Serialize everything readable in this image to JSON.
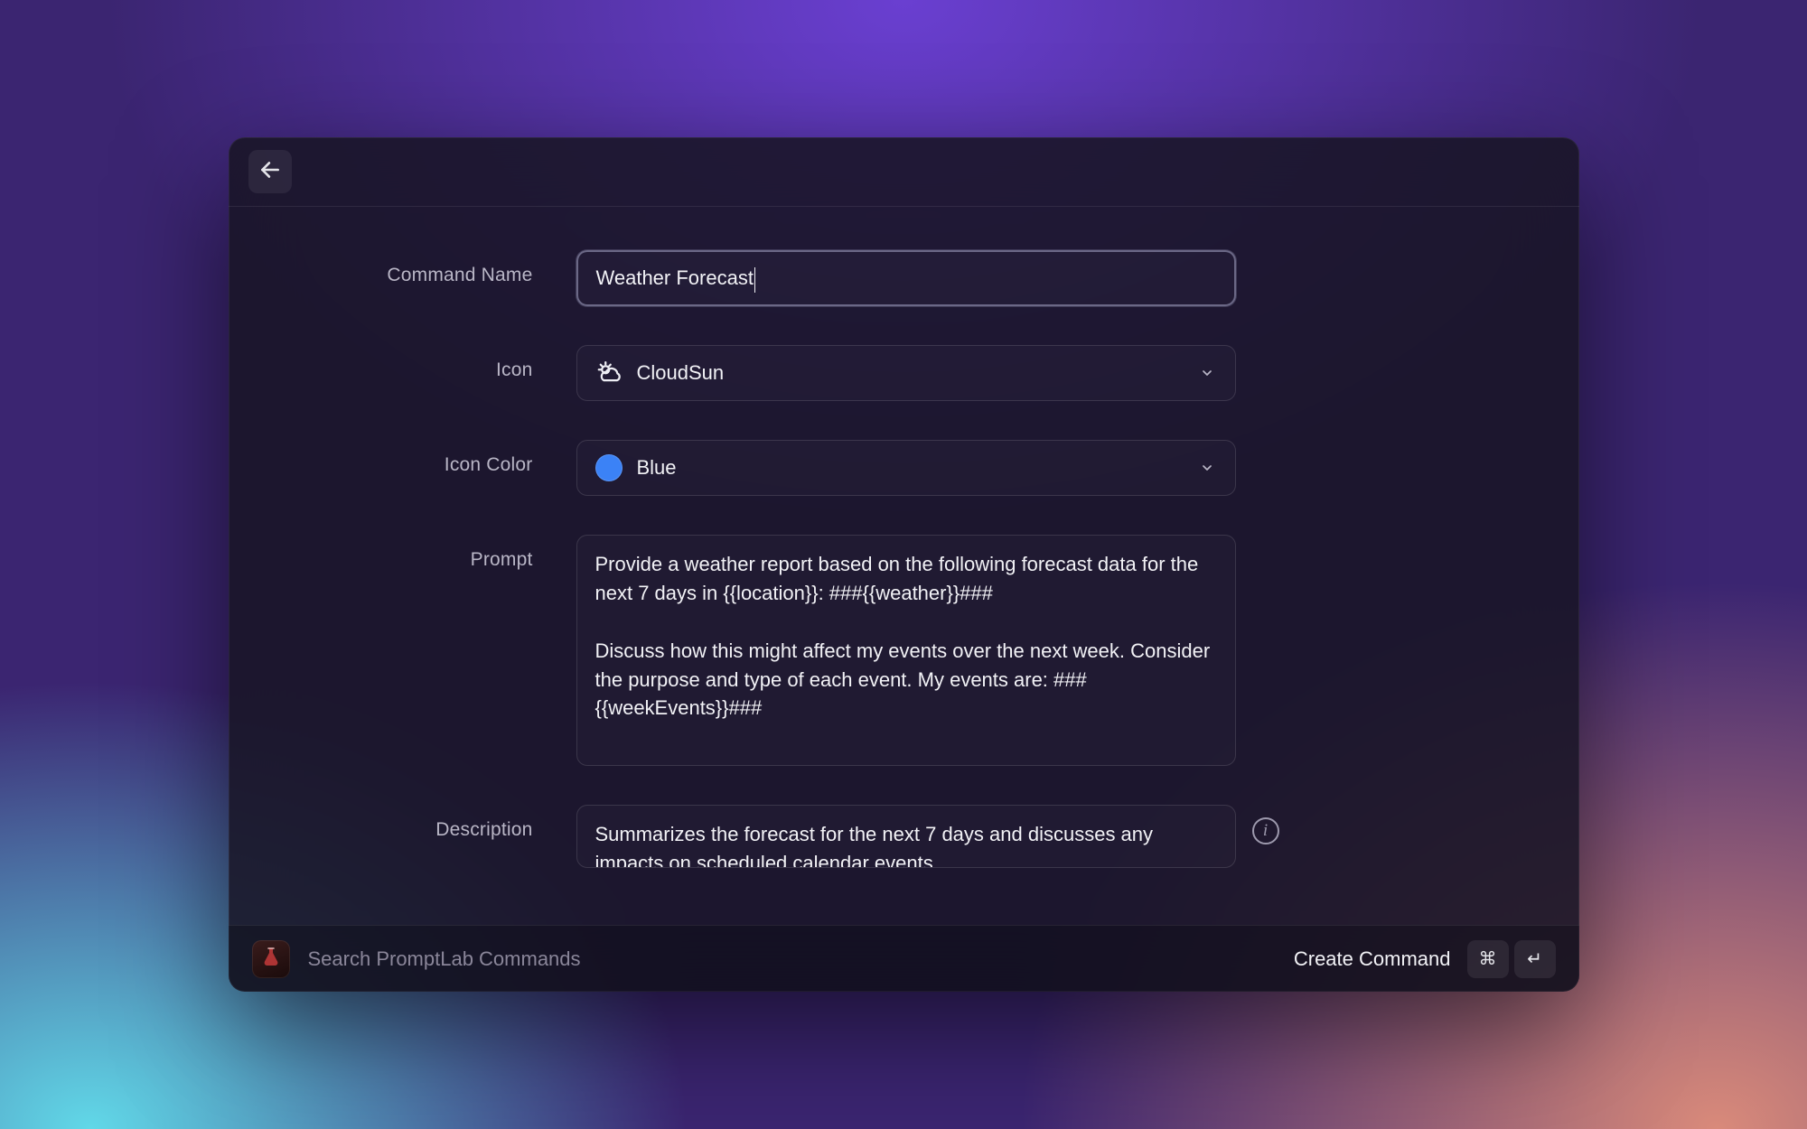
{
  "labels": {
    "command_name": "Command Name",
    "icon": "Icon",
    "icon_color": "Icon Color",
    "prompt": "Prompt",
    "description": "Description"
  },
  "fields": {
    "command_name": {
      "value": "Weather Forecast"
    },
    "icon": {
      "selected": "CloudSun"
    },
    "icon_color": {
      "selected": "Blue",
      "hex": "#3b82f6"
    },
    "prompt": {
      "value": "Provide a weather report based on the following forecast data for the next 7 days in {{location}}: ###{{weather}}###\n\nDiscuss how this might affect my events over the next week. Consider the purpose and type of each event. My events are: ###{{weekEvents}}###"
    },
    "description": {
      "value": "Summarizes the forecast for the next 7 days and discusses any impacts on scheduled calendar events"
    }
  },
  "footer": {
    "search_placeholder": "Search PromptLab Commands",
    "action_label": "Create Command",
    "shortcut": {
      "mod": "⌘",
      "key": "↵"
    }
  },
  "info_glyph": "i"
}
